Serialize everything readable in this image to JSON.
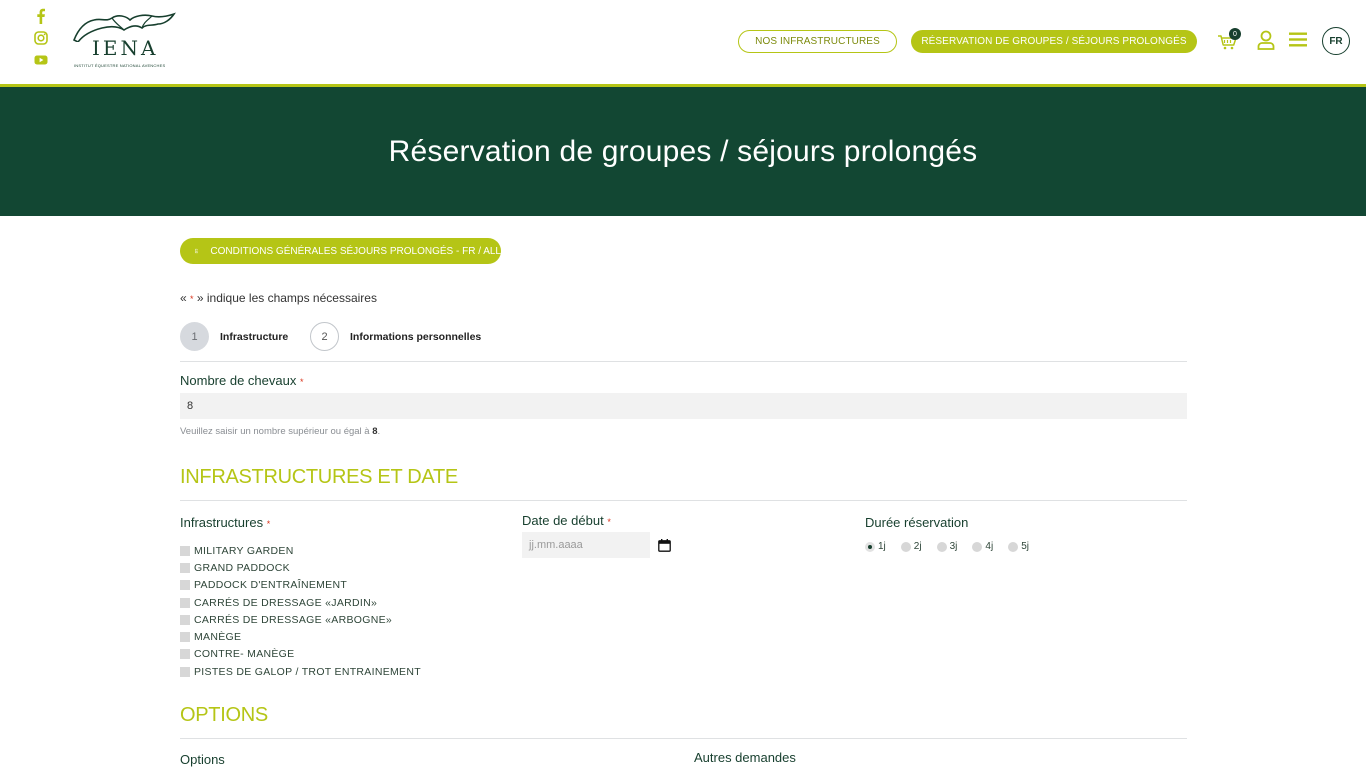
{
  "header": {
    "social": [
      "facebook-icon",
      "instagram-icon",
      "youtube-icon"
    ],
    "logo": {
      "name": "IENA",
      "subtitle": "INSTITUT ÉQUESTRE NATIONAL AVENCHES"
    },
    "nav": {
      "infrastructures": "NOS INFRASTRUCTURES",
      "reservation": "RÉSERVATION DE GROUPES / SÉJOURS PROLONGÉS"
    },
    "cart_count": "0",
    "language": "FR"
  },
  "banner": {
    "title": "Réservation de groupes / séjours prolongés"
  },
  "conditions_button": "CONDITIONS GÉNÉRALES SÉJOURS PROLONGÉS - FR / ALL",
  "required_note": {
    "prefix": "« ",
    "star": "*",
    "suffix": " » indique les champs nécessaires"
  },
  "steps": [
    {
      "number": "1",
      "label": "Infrastructure"
    },
    {
      "number": "2",
      "label": "Informations personnelles"
    }
  ],
  "horses": {
    "label": "Nombre de chevaux",
    "value": "8",
    "hint_prefix": "Veuillez saisir un nombre supérieur ou égal à ",
    "hint_value": "8",
    "hint_suffix": "."
  },
  "section_infra": {
    "title": "INFRASTRUCTURES ET DATE",
    "infra_label": "Infrastructures",
    "infrastructures": [
      "MILITARY GARDEN",
      "GRAND PADDOCK",
      "PADDOCK D'ENTRAÎNEMENT",
      "CARRÉS DE DRESSAGE «JARDIN»",
      "CARRÉS DE DRESSAGE «ARBOGNE»",
      "MANÈGE",
      "CONTRE- MANÈGE",
      "PISTES DE GALOP / TROT ENTRAINEMENT"
    ],
    "date_label": "Date de début",
    "date_placeholder": "jj.mm.aaaa",
    "duration_label": "Durée réservation",
    "durations": [
      "1j",
      "2j",
      "3j",
      "4j",
      "5j"
    ],
    "selected_duration": "1j"
  },
  "section_options": {
    "title": "OPTIONS",
    "options_label": "Options",
    "other_label": "Autres demandes"
  },
  "colors": {
    "accent": "#b5c516",
    "dark_green": "#124733",
    "text": "#173f2e",
    "required": "#d9341c"
  }
}
